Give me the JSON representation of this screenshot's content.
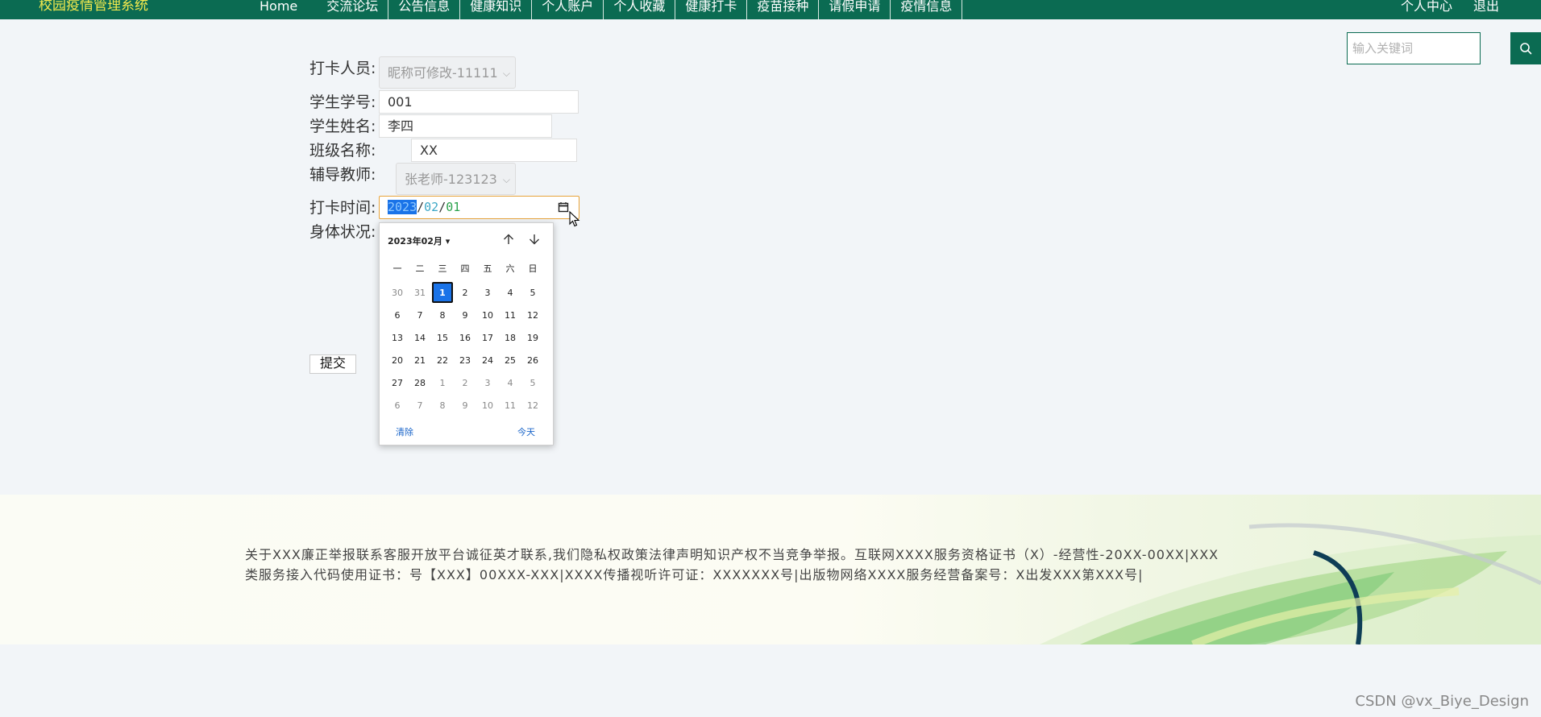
{
  "nav": {
    "brand": "校园疫情管理系统",
    "items": [
      "Home",
      "交流论坛",
      "公告信息",
      "健康知识",
      "个人账户",
      "个人收藏",
      "健康打卡",
      "疫苗接种",
      "请假申请",
      "疫情信息"
    ],
    "right": [
      "个人中心",
      "退出"
    ]
  },
  "search": {
    "placeholder": "输入关键词",
    "icon": "search-icon"
  },
  "form": {
    "labels": {
      "person": "打卡人员:",
      "student_no": "学生学号:",
      "student_name": "学生姓名:",
      "class_name": "班级名称:",
      "teacher": "辅导教师:",
      "time": "打卡时间:",
      "health": "身体状况:"
    },
    "person_value": "昵称可修改-11111",
    "student_no": "001",
    "student_name": "李四",
    "class_name": "XX",
    "teacher_value": "张老师-123123",
    "date": {
      "year": "2023",
      "month": "02",
      "day": "01"
    },
    "submit": "提交"
  },
  "calendar": {
    "title": "2023年02月",
    "weekdays": [
      "一",
      "二",
      "三",
      "四",
      "五",
      "六",
      "日"
    ],
    "days": [
      {
        "d": "30",
        "out": true
      },
      {
        "d": "31",
        "out": true
      },
      {
        "d": "1",
        "selected": true
      },
      {
        "d": "2"
      },
      {
        "d": "3"
      },
      {
        "d": "4"
      },
      {
        "d": "5"
      },
      {
        "d": "6"
      },
      {
        "d": "7"
      },
      {
        "d": "8"
      },
      {
        "d": "9"
      },
      {
        "d": "10"
      },
      {
        "d": "11"
      },
      {
        "d": "12"
      },
      {
        "d": "13"
      },
      {
        "d": "14"
      },
      {
        "d": "15"
      },
      {
        "d": "16"
      },
      {
        "d": "17"
      },
      {
        "d": "18"
      },
      {
        "d": "19"
      },
      {
        "d": "20"
      },
      {
        "d": "21"
      },
      {
        "d": "22"
      },
      {
        "d": "23"
      },
      {
        "d": "24"
      },
      {
        "d": "25"
      },
      {
        "d": "26"
      },
      {
        "d": "27"
      },
      {
        "d": "28"
      },
      {
        "d": "1",
        "out": true
      },
      {
        "d": "2",
        "out": true
      },
      {
        "d": "3",
        "out": true
      },
      {
        "d": "4",
        "out": true
      },
      {
        "d": "5",
        "out": true
      },
      {
        "d": "6",
        "out": true
      },
      {
        "d": "7",
        "out": true
      },
      {
        "d": "8",
        "out": true
      },
      {
        "d": "9",
        "out": true
      },
      {
        "d": "10",
        "out": true
      },
      {
        "d": "11",
        "out": true
      },
      {
        "d": "12",
        "out": true
      }
    ],
    "clear": "清除",
    "today": "今天"
  },
  "footer": {
    "text": "关于XXX廉正举报联系客服开放平台诚征英才联系,我们隐私权政策法律声明知识产权不当竞争举报。互联网XXXX服务资格证书（X）-经营性-20XX-00XX|XXX类服务接入代码使用证书：号【XXX】00XXX-XXX|XXXX传播视听许可证：XXXXXXX号|出版物网络XXXX服务经营备案号：X出发XXX第XXX号|"
  },
  "watermark": "CSDN @vx_Biye_Design",
  "colors": {
    "nav_bg": "#0b6b52",
    "brand": "#f2e94e",
    "accent": "#1a73e8",
    "focus_border": "#e8a33a"
  }
}
